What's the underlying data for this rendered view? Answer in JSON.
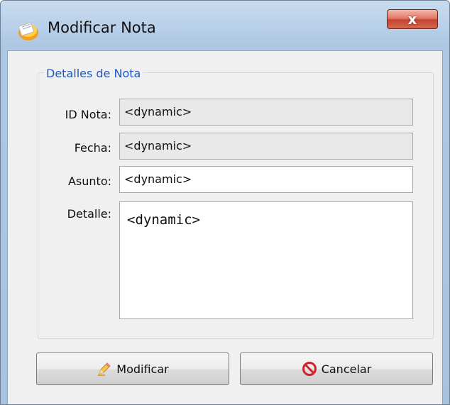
{
  "window": {
    "title": "Modificar Nota",
    "close_glyph": "x",
    "icon": "note-icon"
  },
  "group": {
    "title": "Detalles de Nota"
  },
  "fields": {
    "id_nota": {
      "label": "ID Nota:",
      "value": "<dynamic>"
    },
    "fecha": {
      "label": "Fecha:",
      "value": "<dynamic>"
    },
    "asunto": {
      "label": "Asunto:",
      "value": "<dynamic>"
    },
    "detalle": {
      "label": "Detalle:",
      "value": "<dynamic>"
    }
  },
  "buttons": {
    "modificar": {
      "label": "Modificar",
      "icon": "pencil-icon"
    },
    "cancelar": {
      "label": "Cancelar",
      "icon": "cancel-icon"
    }
  },
  "colors": {
    "group_title": "#1e56c6",
    "close_button": "#c7432f",
    "cancel_icon": "#d4202a"
  }
}
